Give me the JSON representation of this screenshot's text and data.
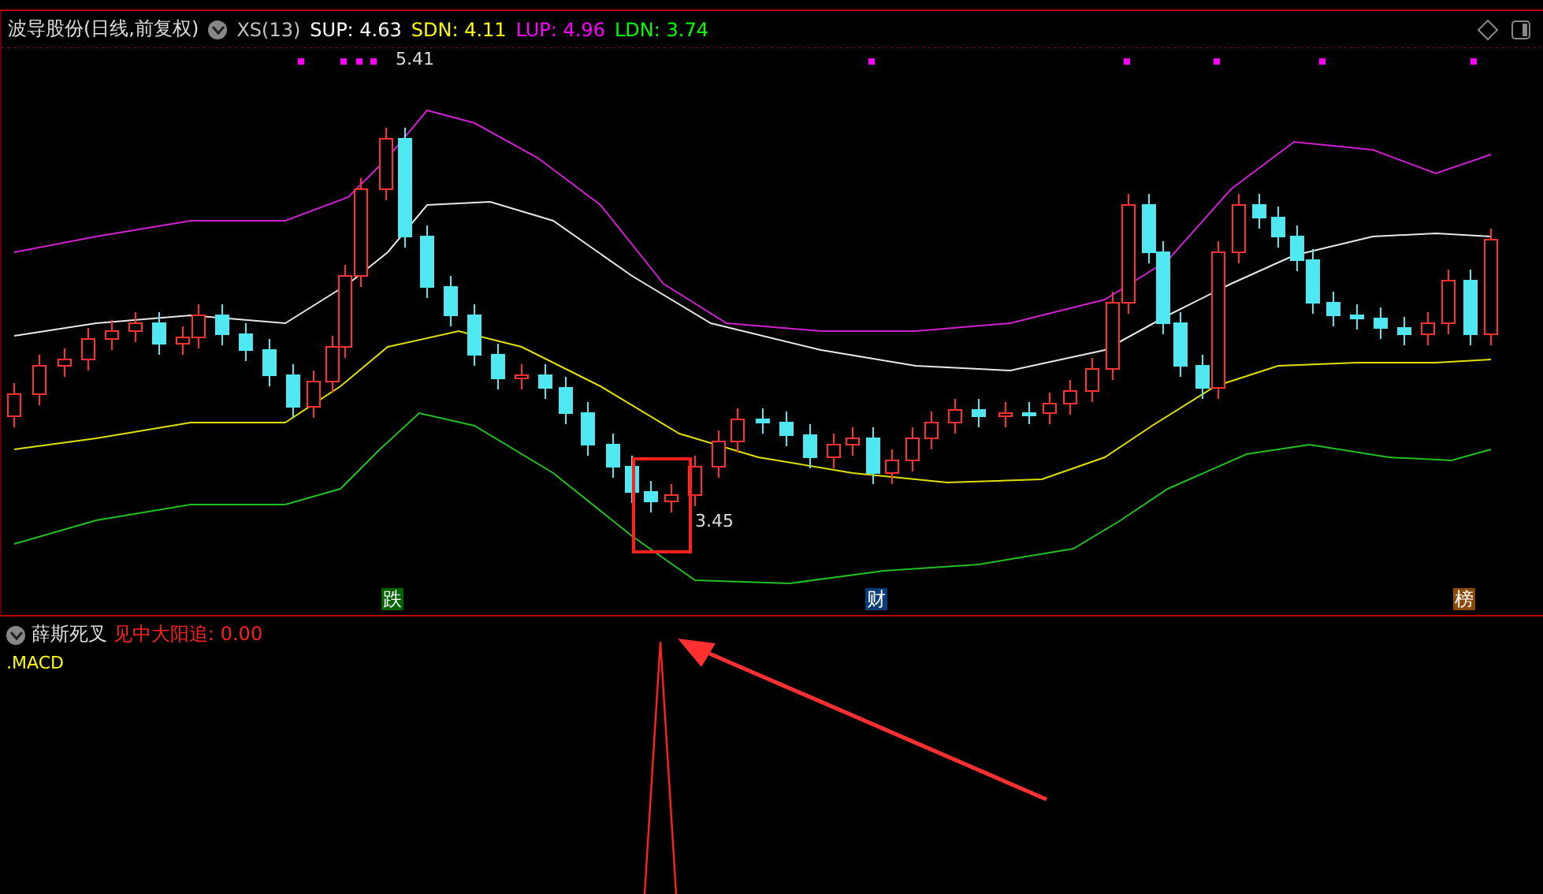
{
  "header": {
    "title": "波导股份(日线,前复权)",
    "indicators": [
      {
        "label": "XS(13)",
        "color": "#c0c0c0"
      },
      {
        "label": "SUP: 4.63",
        "color": "#ffffff"
      },
      {
        "label": "SDN: 4.11",
        "color": "#ffff00"
      },
      {
        "label": "LUP: 4.96",
        "color": "#ff00ff"
      },
      {
        "label": "LDN: 3.74",
        "color": "#00ff00"
      }
    ]
  },
  "price_labels": [
    {
      "kind": "high",
      "text": "5.41"
    },
    {
      "kind": "low",
      "text": "3.45"
    }
  ],
  "event_markers": [
    {
      "text": "跌",
      "color": "#006400"
    },
    {
      "text": "财",
      "color": "#0a3c78"
    },
    {
      "text": "榜",
      "color": "#8b4a08"
    }
  ],
  "sub_panel": {
    "title": "薛斯死叉",
    "signal": "见中大阳追: 0.00",
    "indicator": ".MACD"
  }
}
